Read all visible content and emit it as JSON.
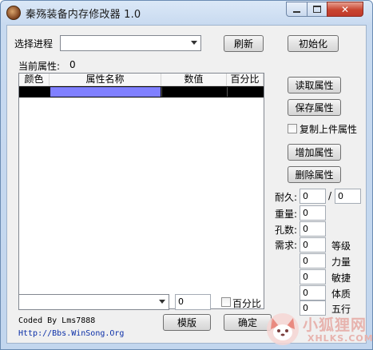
{
  "window": {
    "title": "秦殇装备内存修改器 1.0"
  },
  "top": {
    "process_label": "选择进程",
    "process_value": "",
    "refresh_label": "刷新",
    "init_label": "初始化"
  },
  "current_attr": {
    "label": "当前属性:",
    "value": "0"
  },
  "table": {
    "columns": [
      "颜色",
      "属性名称",
      "数值",
      "百分比"
    ],
    "selected_color": "#8080ff"
  },
  "side_buttons": {
    "read": "读取属性",
    "save": "保存属性",
    "copy_label": "复制上件属性",
    "add": "增加属性",
    "delete": "删除属性"
  },
  "stats": {
    "durability_label": "耐久:",
    "durability_value": "0",
    "durability_sep": "/",
    "durability_max": "0",
    "weight_label": "重量:",
    "weight_value": "0",
    "holes_label": "孔数:",
    "holes_value": "0",
    "require_label": "需求:",
    "requirements": [
      {
        "value": "0",
        "label": "等级"
      },
      {
        "value": "0",
        "label": "力量"
      },
      {
        "value": "0",
        "label": "敏捷"
      },
      {
        "value": "0",
        "label": "体质"
      },
      {
        "value": "0",
        "label": "五行"
      }
    ]
  },
  "bottom": {
    "attr_value": "",
    "number_value": "0",
    "percent_label": "百分比",
    "credit": "Coded By Lms7888",
    "url": "Http://Bbs.WinSong.Org",
    "template_label": "模版",
    "ok_label": "确定"
  },
  "watermark": {
    "cn": "小狐狸网",
    "en": "XHLKS.COM"
  }
}
